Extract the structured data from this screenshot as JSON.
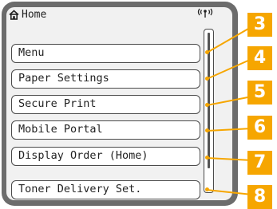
{
  "header": {
    "title": "Home",
    "home_icon": "home-icon",
    "signal_icon": "wireless-signal-icon"
  },
  "menu": {
    "items": [
      {
        "label": "Menu"
      },
      {
        "label": "Paper Settings"
      },
      {
        "label": "Secure Print"
      },
      {
        "label": "Mobile Portal"
      },
      {
        "label": "Display Order (Home)"
      },
      {
        "label": "Toner Delivery Set."
      }
    ]
  },
  "callouts": [
    "3",
    "4",
    "5",
    "6",
    "7",
    "8"
  ],
  "colors": {
    "bezel": "#6c6c6c",
    "screen": "#f1f1f1",
    "callout": "#f6a600"
  }
}
